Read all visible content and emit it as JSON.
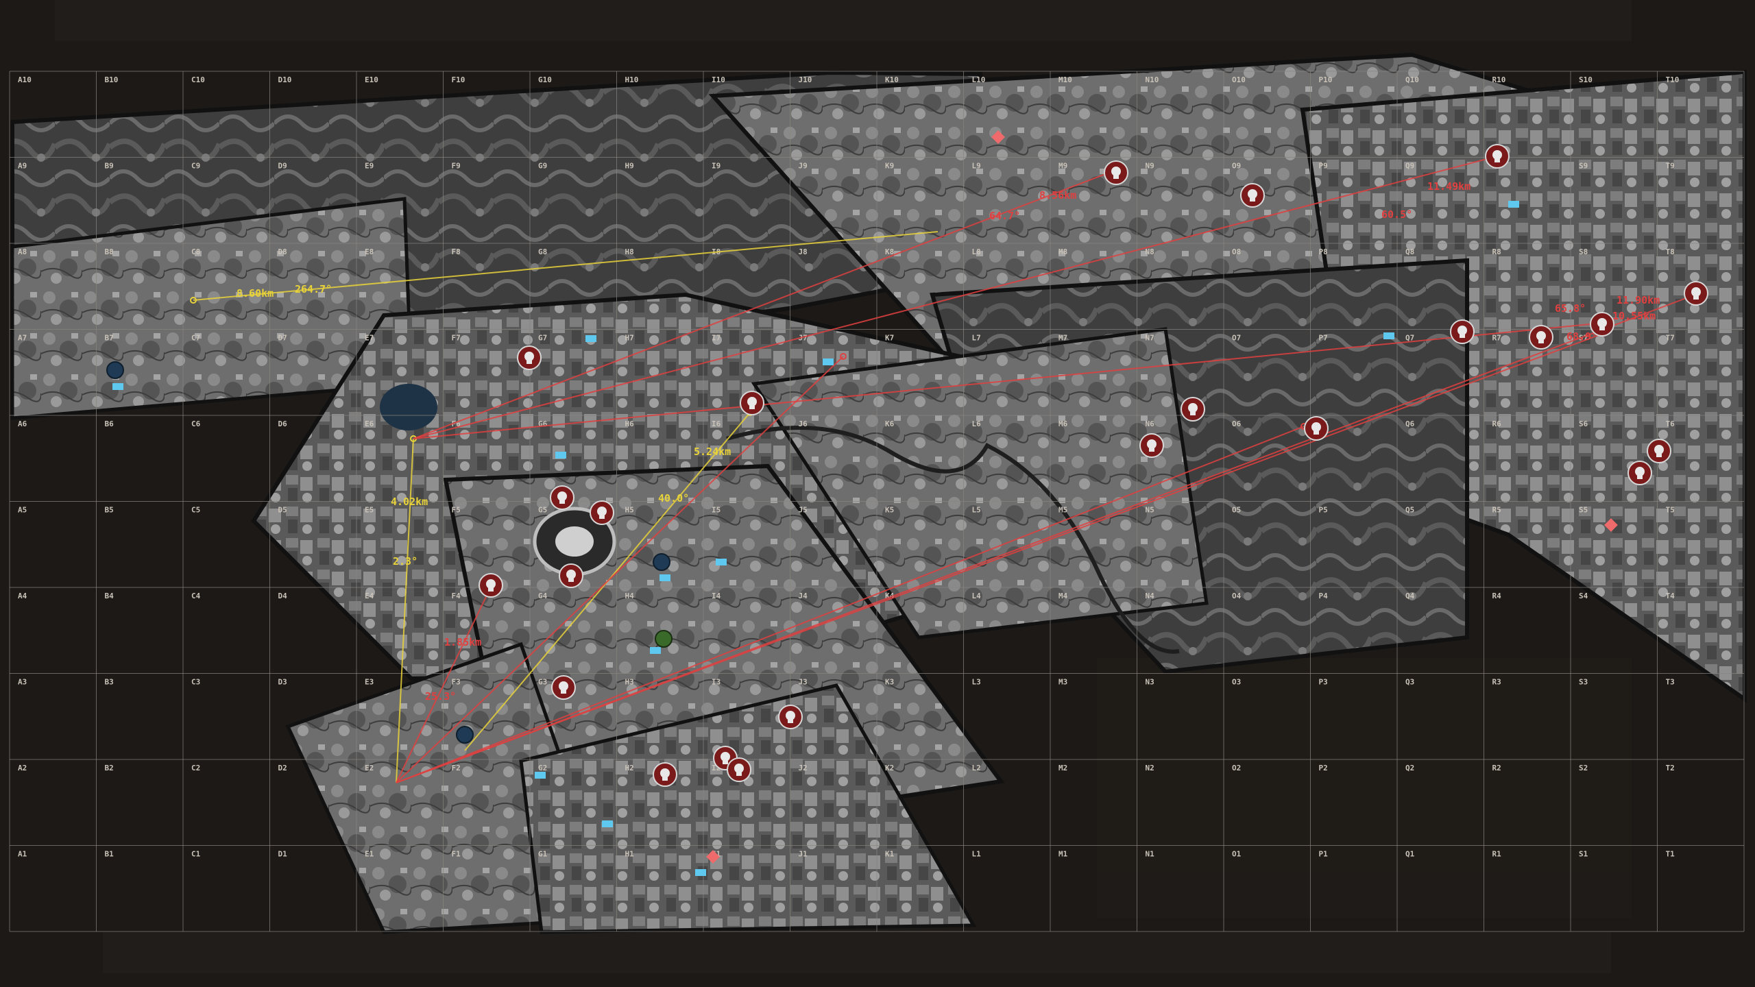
{
  "grid": {
    "columns": [
      "A",
      "B",
      "C",
      "D",
      "E",
      "F",
      "G",
      "H",
      "I",
      "J",
      "K",
      "L",
      "M",
      "N",
      "O",
      "P",
      "Q",
      "R",
      "S",
      "T"
    ],
    "rows": [
      "10",
      "9",
      "8",
      "7",
      "6",
      "5",
      "4",
      "3",
      "2",
      "1"
    ]
  },
  "measurements": [
    {
      "id": "m1",
      "color": "#e8d23a",
      "distance": "8.60km",
      "bearing": "264.7°"
    },
    {
      "id": "m2",
      "color": "#e8d23a",
      "distance": "4.02km",
      "bearing": "2.3°"
    },
    {
      "id": "m3",
      "color": "#e8d23a",
      "distance": "5.24km",
      "bearing": "40.0°"
    },
    {
      "id": "m4",
      "color": "#e04040",
      "distance": "1.85km",
      "bearing": "25.3°"
    },
    {
      "id": "m5",
      "color": "#e04040",
      "distance": "8.56km",
      "bearing": "64.7°"
    },
    {
      "id": "m6",
      "color": "#e04040",
      "distance": "11.49km",
      "bearing": "60.5°"
    },
    {
      "id": "m7",
      "color": "#e04040",
      "distance": "11.90km",
      "bearing": "65.8°"
    },
    {
      "id": "m8",
      "color": "#e04040",
      "distance": "10.55km",
      "bearing": "68.9°"
    }
  ],
  "colors": {
    "background": "#1c1916",
    "grid_line": "#8a8580",
    "enemy_marker": "#7a1a1a",
    "friendly_marker": "#1e3a55",
    "objective_marker": "#3a6a2a",
    "intel_marker": "#5ec8ef",
    "target_diamond": "#ef6a6a"
  },
  "icons": {
    "enemy": "skull-marker-icon",
    "friendly": "blue-pin-icon",
    "objective": "green-pin-icon",
    "intel": "intel-tag-icon",
    "target": "diamond-target-icon"
  }
}
